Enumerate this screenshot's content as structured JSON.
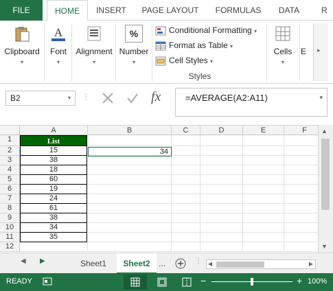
{
  "ribbon_tabs": [
    "FILE",
    "HOME",
    "INSERT",
    "PAGE LAYOUT",
    "FORMULAS",
    "DATA",
    "R"
  ],
  "ribbon": {
    "clipboard": "Clipboard",
    "font": "Font",
    "alignment": "Alignment",
    "number": "Number",
    "number_symbol": "%",
    "conditional_formatting": "Conditional Formatting",
    "format_as_table": "Format as Table",
    "cell_styles": "Cell Styles",
    "styles_group": "Styles",
    "cells": "Cells",
    "editing": "E"
  },
  "formula_bar": {
    "name_box": "B2",
    "formula": "=AVERAGE(A2:A11)",
    "fx": "fx"
  },
  "columns": [
    "A",
    "B",
    "C",
    "D",
    "E",
    "F"
  ],
  "rows": [
    "1",
    "2",
    "3",
    "4",
    "5",
    "6",
    "7",
    "8",
    "9",
    "10",
    "11",
    "12"
  ],
  "table": {
    "header": "List",
    "values": [
      "15",
      "38",
      "18",
      "60",
      "19",
      "24",
      "61",
      "38",
      "34",
      "35"
    ]
  },
  "result_cell": "34",
  "sheets": [
    "Sheet1",
    "Sheet2"
  ],
  "sheet_more": "...",
  "status": {
    "mode": "READY",
    "zoom": "100%"
  }
}
